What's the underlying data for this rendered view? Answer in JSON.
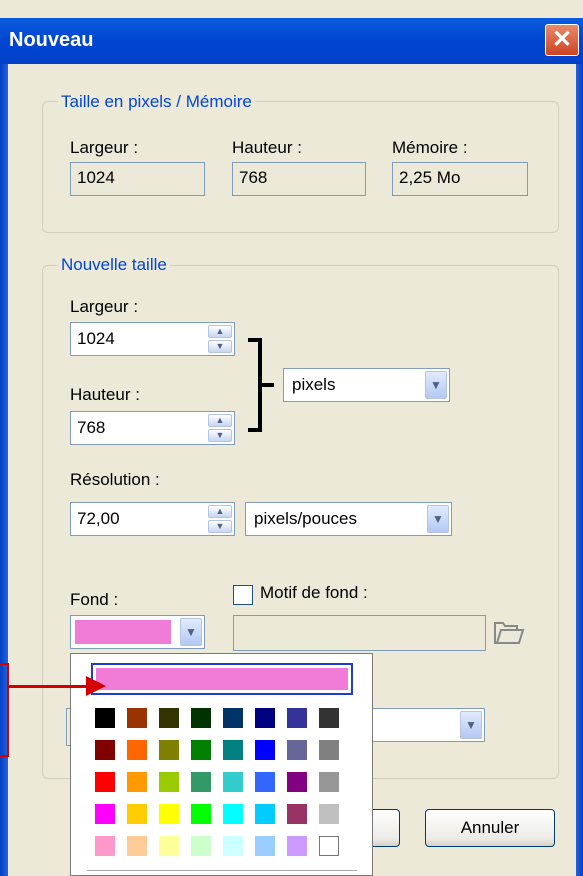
{
  "window": {
    "title": "Nouveau",
    "close_glyph": "✕"
  },
  "memory_group": {
    "legend": "Taille en pixels / Mémoire",
    "width_label": "Largeur :",
    "width_value": "1024",
    "height_label": "Hauteur :",
    "height_value": "768",
    "memory_label": "Mémoire :",
    "memory_value": "2,25 Mo"
  },
  "size_group": {
    "legend": "Nouvelle taille",
    "width_label": "Largeur :",
    "width_value": "1024",
    "height_label": "Hauteur :",
    "height_value": "768",
    "unit_value": "pixels",
    "resolution_label": "Résolution :",
    "resolution_value": "72,00",
    "resolution_unit_value": "pixels/pouces"
  },
  "background": {
    "label": "Fond :",
    "selected_color": "#f07cd8",
    "pattern_label": "Motif de fond :",
    "pattern_value": ""
  },
  "buttons": {
    "cancel_label": "Annuler"
  },
  "color_popup": {
    "selected_color": "#f07cd8",
    "colors": [
      [
        "#000000",
        "#993300",
        "#333300",
        "#003300",
        "#003366",
        "#000080",
        "#333399",
        "#333333"
      ],
      [
        "#800000",
        "#ff6600",
        "#808000",
        "#008000",
        "#008080",
        "#0000ff",
        "#666699",
        "#808080"
      ],
      [
        "#ff0000",
        "#ff9900",
        "#99cc00",
        "#339966",
        "#33cccc",
        "#3366ff",
        "#800080",
        "#969696"
      ],
      [
        "#ff00ff",
        "#ffcc00",
        "#ffff00",
        "#00ff00",
        "#00ffff",
        "#00ccff",
        "#993366",
        "#c0c0c0"
      ],
      [
        "#ff99cc",
        "#ffcc99",
        "#ffff99",
        "#ccffcc",
        "#ccffff",
        "#99ccff",
        "#cc99ff",
        "#ffffff"
      ]
    ]
  },
  "annotation": {
    "color": "#d40000"
  }
}
